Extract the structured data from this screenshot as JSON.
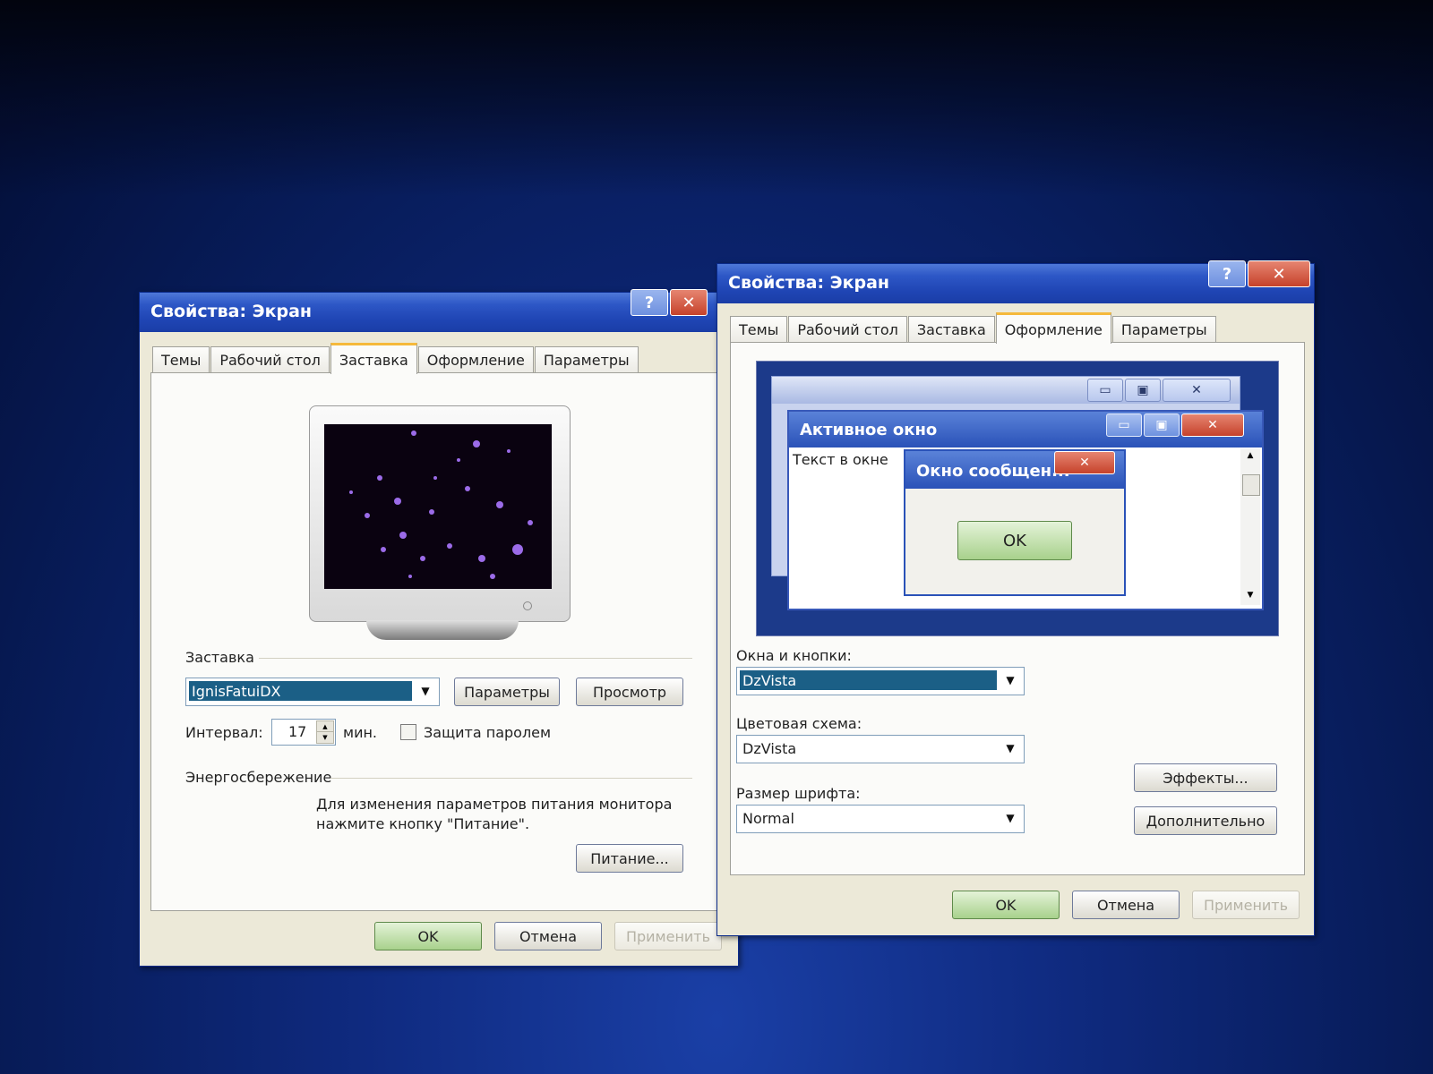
{
  "window_left": {
    "title": "Свойства: Экран",
    "tabs": [
      "Темы",
      "Рабочий стол",
      "Заставка",
      "Оформление",
      "Параметры"
    ],
    "active_tab": "Заставка",
    "screensaver_group": "Заставка",
    "screensaver_value": "IgnisFatuiDX",
    "settings_button": "Параметры",
    "preview_button": "Просмотр",
    "interval_label": "Интервал:",
    "interval_value": "17",
    "interval_unit": "мин.",
    "password_label": "Защита паролем",
    "power_group": "Энергосбережение",
    "power_text_1": "Для изменения параметров питания монитора",
    "power_text_2": "нажмите кнопку \"Питание\".",
    "power_button": "Питание...",
    "ok": "OK",
    "cancel": "Отмена",
    "apply": "Применить"
  },
  "window_right": {
    "title": "Свойства: Экран",
    "tabs": [
      "Темы",
      "Рабочий стол",
      "Заставка",
      "Оформление",
      "Параметры"
    ],
    "active_tab": "Оформление",
    "preview": {
      "active_window_title": "Активное окно",
      "window_text": "Текст в окне",
      "message_title": "Окно сообщен...",
      "message_ok": "OK"
    },
    "windows_buttons_label": "Окна и кнопки:",
    "windows_buttons_value": "DzVista",
    "color_scheme_label": "Цветовая схема:",
    "color_scheme_value": "DzVista",
    "font_size_label": "Размер шрифта:",
    "font_size_value": "Normal",
    "effects_button": "Эффекты...",
    "advanced_button": "Дополнительно",
    "ok": "OK",
    "cancel": "Отмена",
    "apply": "Применить"
  }
}
